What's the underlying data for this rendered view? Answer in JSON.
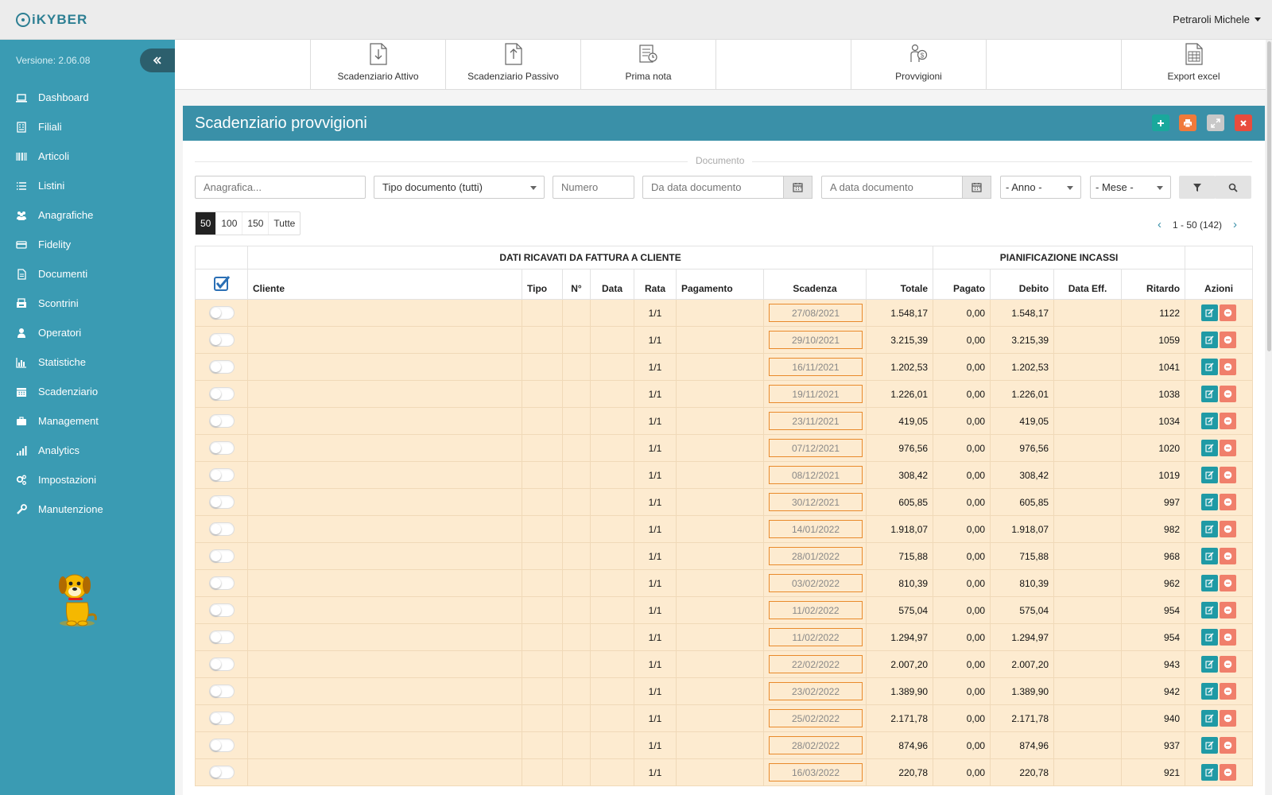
{
  "app": {
    "logo_text": "iKYBER",
    "user": "Petraroli Michele",
    "version": "Versione: 2.06.08"
  },
  "sidebar": {
    "items": [
      {
        "label": "Dashboard",
        "icon": "laptop-icon"
      },
      {
        "label": "Filiali",
        "icon": "building-icon"
      },
      {
        "label": "Articoli",
        "icon": "barcode-icon"
      },
      {
        "label": "Listini",
        "icon": "list-icon"
      },
      {
        "label": "Anagrafiche",
        "icon": "users-icon"
      },
      {
        "label": "Fidelity",
        "icon": "card-icon"
      },
      {
        "label": "Documenti",
        "icon": "document-icon"
      },
      {
        "label": "Scontrini",
        "icon": "receipt-icon"
      },
      {
        "label": "Operatori",
        "icon": "user-icon"
      },
      {
        "label": "Statistiche",
        "icon": "bar-chart-icon"
      },
      {
        "label": "Scadenziario",
        "icon": "calendar-icon"
      },
      {
        "label": "Management",
        "icon": "briefcase-icon"
      },
      {
        "label": "Analytics",
        "icon": "signal-icon"
      },
      {
        "label": "Impostazioni",
        "icon": "cogs-icon"
      },
      {
        "label": "Manutenzione",
        "icon": "wrench-icon"
      }
    ]
  },
  "toolbar": {
    "items": [
      {
        "label": "Scadenziario Attivo",
        "icon": "document-download-icon"
      },
      {
        "label": "Scadenziario Passivo",
        "icon": "document-upload-icon"
      },
      {
        "label": "Prima nota",
        "icon": "ledger-icon"
      },
      {
        "label": "",
        "icon": ""
      },
      {
        "label": "Provvigioni",
        "icon": "commission-icon"
      },
      {
        "label": "",
        "icon": ""
      },
      {
        "label": "Export excel",
        "icon": "excel-icon"
      }
    ]
  },
  "panel": {
    "title": "Scadenziario provvigioni",
    "legend": "Documento"
  },
  "filters": {
    "anagrafica_placeholder": "Anagrafica...",
    "tipo_documento": "Tipo documento (tutti)",
    "numero_placeholder": "Numero",
    "da_data_placeholder": "Da data documento",
    "a_data_placeholder": "A data documento",
    "anno": "- Anno -",
    "mese": "- Mese -"
  },
  "pagination": {
    "sizes": [
      "50",
      "100",
      "150",
      "Tutte"
    ],
    "active": "50",
    "info": "1 - 50 (142)",
    "prev": "‹",
    "next": "›"
  },
  "table": {
    "group_headers": {
      "left": "DATI RICAVATI DA FATTURA A CLIENTE",
      "right": "PIANIFICAZIONE INCASSI"
    },
    "columns": {
      "cliente": "Cliente",
      "tipo": "Tipo",
      "numero": "N°",
      "data": "Data",
      "rata": "Rata",
      "pagamento": "Pagamento",
      "scadenza": "Scadenza",
      "totale": "Totale",
      "pagato": "Pagato",
      "debito": "Debito",
      "data_eff": "Data Eff.",
      "ritardo": "Ritardo",
      "azioni": "Azioni"
    },
    "rows": [
      {
        "rata": "1/1",
        "scadenza": "27/08/2021",
        "totale": "1.548,17",
        "pagato": "0,00",
        "debito": "1.548,17",
        "ritardo": "1122"
      },
      {
        "rata": "1/1",
        "scadenza": "29/10/2021",
        "totale": "3.215,39",
        "pagato": "0,00",
        "debito": "3.215,39",
        "ritardo": "1059"
      },
      {
        "rata": "1/1",
        "scadenza": "16/11/2021",
        "totale": "1.202,53",
        "pagato": "0,00",
        "debito": "1.202,53",
        "ritardo": "1041"
      },
      {
        "rata": "1/1",
        "scadenza": "19/11/2021",
        "totale": "1.226,01",
        "pagato": "0,00",
        "debito": "1.226,01",
        "ritardo": "1038"
      },
      {
        "rata": "1/1",
        "scadenza": "23/11/2021",
        "totale": "419,05",
        "pagato": "0,00",
        "debito": "419,05",
        "ritardo": "1034"
      },
      {
        "rata": "1/1",
        "scadenza": "07/12/2021",
        "totale": "976,56",
        "pagato": "0,00",
        "debito": "976,56",
        "ritardo": "1020"
      },
      {
        "rata": "1/1",
        "scadenza": "08/12/2021",
        "totale": "308,42",
        "pagato": "0,00",
        "debito": "308,42",
        "ritardo": "1019"
      },
      {
        "rata": "1/1",
        "scadenza": "30/12/2021",
        "totale": "605,85",
        "pagato": "0,00",
        "debito": "605,85",
        "ritardo": "997"
      },
      {
        "rata": "1/1",
        "scadenza": "14/01/2022",
        "totale": "1.918,07",
        "pagato": "0,00",
        "debito": "1.918,07",
        "ritardo": "982"
      },
      {
        "rata": "1/1",
        "scadenza": "28/01/2022",
        "totale": "715,88",
        "pagato": "0,00",
        "debito": "715,88",
        "ritardo": "968"
      },
      {
        "rata": "1/1",
        "scadenza": "03/02/2022",
        "totale": "810,39",
        "pagato": "0,00",
        "debito": "810,39",
        "ritardo": "962"
      },
      {
        "rata": "1/1",
        "scadenza": "11/02/2022",
        "totale": "575,04",
        "pagato": "0,00",
        "debito": "575,04",
        "ritardo": "954"
      },
      {
        "rata": "1/1",
        "scadenza": "11/02/2022",
        "totale": "1.294,97",
        "pagato": "0,00",
        "debito": "1.294,97",
        "ritardo": "954"
      },
      {
        "rata": "1/1",
        "scadenza": "22/02/2022",
        "totale": "2.007,20",
        "pagato": "0,00",
        "debito": "2.007,20",
        "ritardo": "943"
      },
      {
        "rata": "1/1",
        "scadenza": "23/02/2022",
        "totale": "1.389,90",
        "pagato": "0,00",
        "debito": "1.389,90",
        "ritardo": "942"
      },
      {
        "rata": "1/1",
        "scadenza": "25/02/2022",
        "totale": "2.171,78",
        "pagato": "0,00",
        "debito": "2.171,78",
        "ritardo": "940"
      },
      {
        "rata": "1/1",
        "scadenza": "28/02/2022",
        "totale": "874,96",
        "pagato": "0,00",
        "debito": "874,96",
        "ritardo": "937"
      },
      {
        "rata": "1/1",
        "scadenza": "16/03/2022",
        "totale": "220,78",
        "pagato": "0,00",
        "debito": "220,78",
        "ritardo": "921"
      }
    ]
  },
  "colors": {
    "sidebar": "#3a9bb3",
    "panel_header": "#3a90a8",
    "row_bg": "#fdebd0",
    "date_border": "#e98a2b",
    "edit_button": "#1f9aa5",
    "delete_button": "#f07f6b",
    "add_button": "#1aa89c",
    "print_button": "#f07a3a",
    "expand_button": "#c8c8c8",
    "close_button": "#e84c3d"
  }
}
